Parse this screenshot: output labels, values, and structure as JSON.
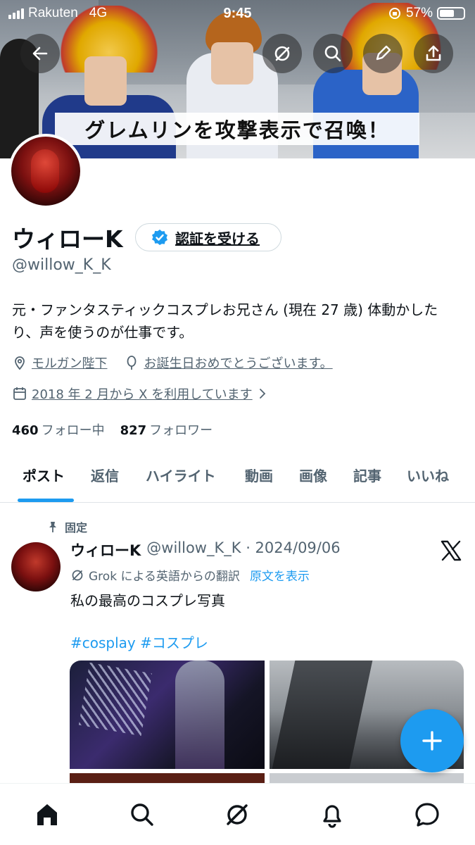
{
  "status_bar": {
    "carrier": "Rakuten",
    "network": "4G",
    "time": "9:45",
    "battery": "57%"
  },
  "banner": {
    "text": "グレムリンを攻撃表示で召喚！"
  },
  "profile": {
    "name": "ウィローK",
    "verify_label": "認証を受ける",
    "handle": "@willow_K_K",
    "bio": "元・ファンタスティックコスプレお兄さん (現在 27 歳) 体動かしたり、声を使うのが仕事です。",
    "location": "モルガン陛下",
    "birthday": "お誕生日おめでとうございます。",
    "joined": "2018 年 2 月から X を利用しています",
    "following_count": "460",
    "following_label": "フォロー中",
    "followers_count": "827",
    "followers_label": "フォロワー"
  },
  "tabs": [
    "ポスト",
    "返信",
    "ハイライト",
    "動画",
    "画像",
    "記事",
    "いいね"
  ],
  "post": {
    "pinned_label": "固定",
    "author": "ウィローK",
    "handle_date": "@willow_K_K · 2024/09/06",
    "translation": "Grok による英語からの翻訳",
    "show_original": "原文を表示",
    "text": "私の最高のコスプレ写真",
    "hashtags": "#cosplay #コスプレ"
  },
  "colors": {
    "accent": "#1d9bf0",
    "text": "#0f1419",
    "muted": "#536471"
  },
  "icons": {
    "banner_buttons": [
      "back-arrow-icon",
      "grok-icon",
      "search-icon",
      "edit-icon",
      "share-icon"
    ],
    "bottom_nav": [
      "home-icon",
      "search-icon",
      "grok-icon",
      "bell-icon",
      "message-icon"
    ]
  }
}
